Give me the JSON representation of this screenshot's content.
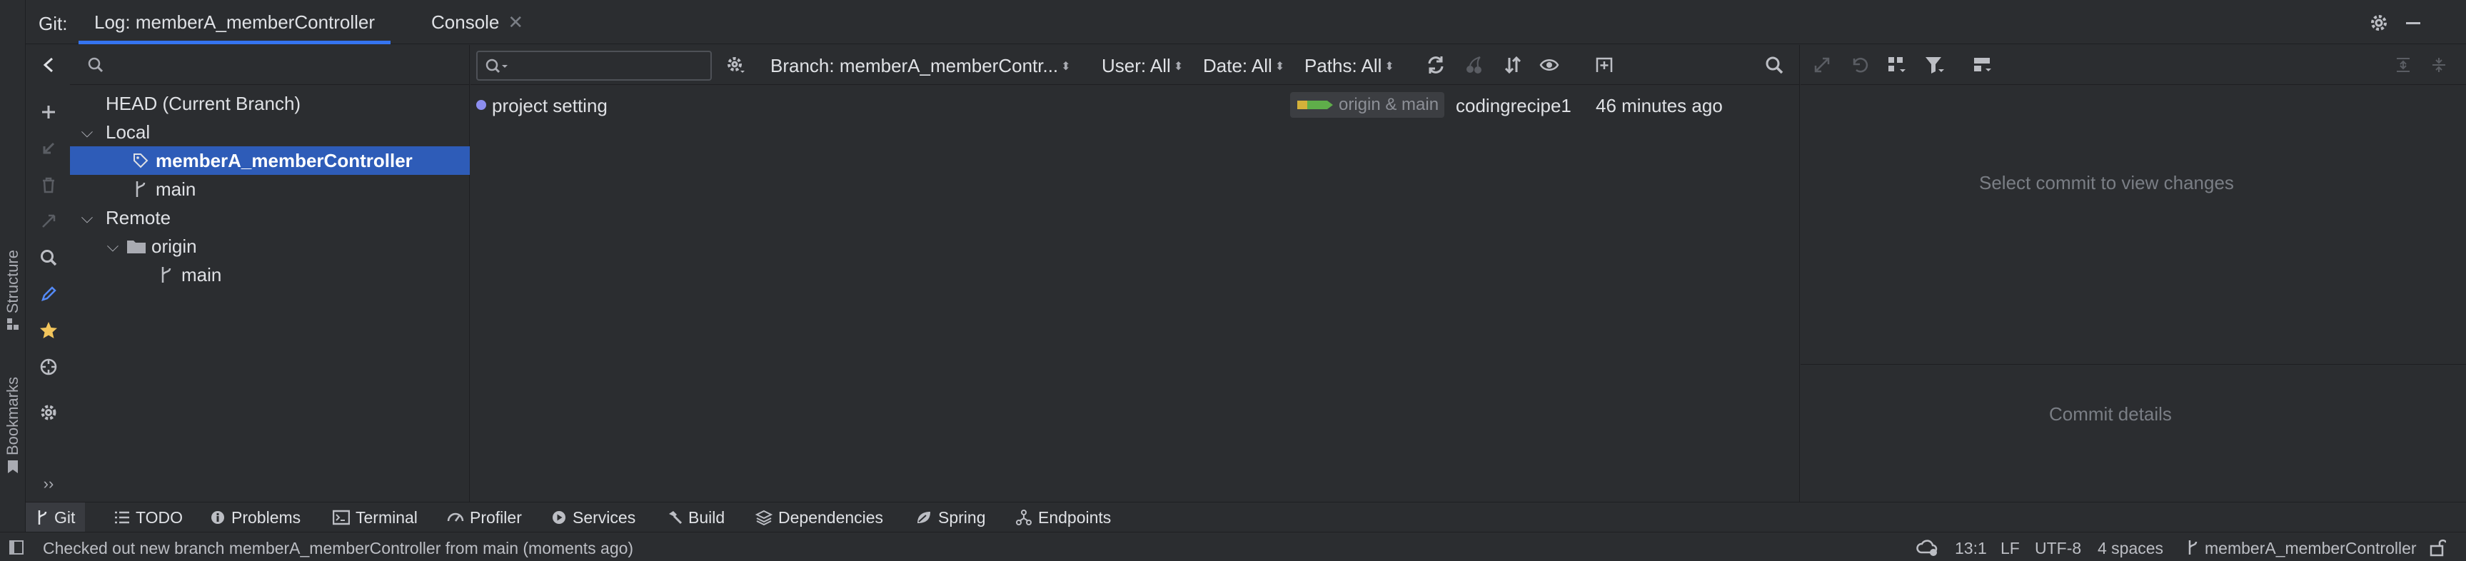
{
  "window": {
    "tool_title": "Git:",
    "tabs": [
      {
        "label": "Log: memberA_memberController",
        "active": true
      },
      {
        "label": "Console",
        "active": false,
        "closable": true
      }
    ]
  },
  "side_labels": [
    "Structure",
    "Bookmarks"
  ],
  "branches": {
    "search_placeholder": "",
    "head": "HEAD (Current Branch)",
    "local_group": "Local",
    "local_items": [
      "memberA_memberController",
      "main"
    ],
    "remote_group": "Remote",
    "remote_origin": "origin",
    "remote_items": [
      "main"
    ]
  },
  "log": {
    "filter_placeholder": "",
    "filters": {
      "branch": "Branch: memberA_memberContr...",
      "user": "User: All",
      "date": "Date: All",
      "paths": "Paths: All"
    },
    "commits": [
      {
        "message": "project setting",
        "refs": "origin & main",
        "author": "codingrecipe1",
        "date": "46 minutes ago",
        "colors": {
          "dot": "#8c8ef0",
          "tag1": "#d4b13a",
          "tag2": "#5fae4a"
        }
      }
    ]
  },
  "changes": {
    "empty_text": "Select commit to view changes",
    "details_text": "Commit details"
  },
  "tool_tabs": [
    "Git",
    "TODO",
    "Problems",
    "Terminal",
    "Profiler",
    "Services",
    "Build",
    "Dependencies",
    "Spring",
    "Endpoints"
  ],
  "status": {
    "message": "Checked out new branch memberA_memberController from main (moments ago)",
    "position": "13:1",
    "line_sep": "LF",
    "encoding": "UTF-8",
    "indent": "4 spaces",
    "branch": "memberA_memberController"
  },
  "colors": {
    "accent": "#3574f0",
    "selection": "#2e5cb8",
    "star": "#f2c55c"
  }
}
